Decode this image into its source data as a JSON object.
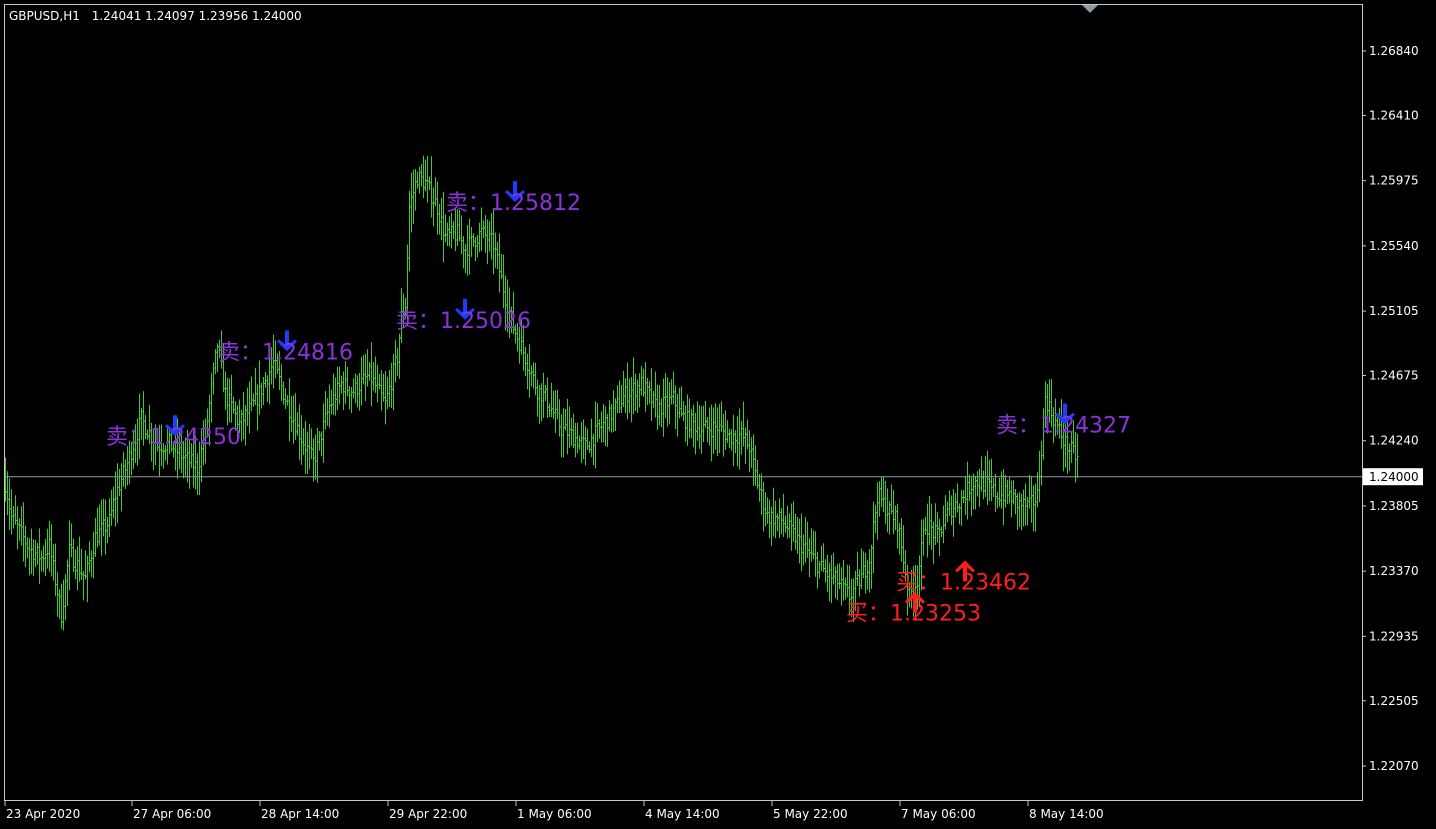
{
  "header": {
    "symbol_timeframe": "GBPUSD,H1",
    "ohlc": "1.24041 1.24097 1.23956 1.24000"
  },
  "colors": {
    "background": "#000000",
    "frame": "#c8c8c8",
    "bars": "#46c832",
    "price_line": "#8c9ba5",
    "sell_arrow": "#1e3cff",
    "buy_arrow": "#ff1e1e",
    "sell_label": "#8c32dc",
    "buy_label": "#ff1e1e",
    "triangle": "#8c9ba5"
  },
  "chart_data": {
    "type": "ohlc",
    "symbol": "GBPUSD",
    "timeframe": "H1",
    "y_ticks": [
      "1.26840",
      "1.26410",
      "1.25975",
      "1.25540",
      "1.25105",
      "1.24675",
      "1.24240",
      "1.23805",
      "1.23370",
      "1.22935",
      "1.22505",
      "1.22070"
    ],
    "ylim": [
      1.2175,
      1.2708
    ],
    "x_ticks": [
      "23 Apr 2020",
      "27 Apr 06:00",
      "28 Apr 14:00",
      "29 Apr 22:00",
      "1 May 06:00",
      "4 May 14:00",
      "5 May 22:00",
      "7 May 06:00",
      "8 May 14:00"
    ],
    "current_price": "1.24000",
    "bar_count": 270,
    "trend_close": [
      [
        0,
        1.2396
      ],
      [
        3,
        1.2373
      ],
      [
        12,
        1.2352
      ],
      [
        18,
        1.2346
      ],
      [
        22,
        1.2354
      ],
      [
        28,
        1.2308
      ],
      [
        32,
        1.235
      ],
      [
        40,
        1.2332
      ],
      [
        45,
        1.236
      ],
      [
        52,
        1.237
      ],
      [
        55,
        1.2388
      ],
      [
        60,
        1.2405
      ],
      [
        68,
        1.2438
      ],
      [
        76,
        1.2421
      ],
      [
        82,
        1.2422
      ],
      [
        89,
        1.2413
      ],
      [
        96,
        1.2406
      ],
      [
        100,
        1.2428
      ],
      [
        106,
        1.2488
      ],
      [
        110,
        1.2455
      ],
      [
        117,
        1.2435
      ],
      [
        125,
        1.245
      ],
      [
        134,
        1.2476
      ],
      [
        140,
        1.2452
      ],
      [
        148,
        1.2426
      ],
      [
        154,
        1.241
      ],
      [
        162,
        1.2447
      ],
      [
        168,
        1.2462
      ],
      [
        174,
        1.2457
      ],
      [
        182,
        1.2468
      ],
      [
        190,
        1.2448
      ],
      [
        196,
        1.248
      ],
      [
        198,
        1.2507
      ],
      [
        200,
        1.2515
      ],
      [
        202,
        1.258
      ],
      [
        206,
        1.26
      ],
      [
        210,
        1.2596
      ],
      [
        216,
        1.258
      ],
      [
        220,
        1.256
      ],
      [
        226,
        1.2562
      ],
      [
        230,
        1.2552
      ],
      [
        238,
        1.2563
      ],
      [
        244,
        1.2555
      ],
      [
        250,
        1.252
      ],
      [
        254,
        1.25
      ],
      [
        260,
        1.248
      ],
      [
        266,
        1.2458
      ],
      [
        270,
        1.2453
      ],
      [
        278,
        1.2432
      ],
      [
        284,
        1.2427
      ],
      [
        290,
        1.242
      ],
      [
        296,
        1.243
      ],
      [
        302,
        1.244
      ],
      [
        310,
        1.2455
      ],
      [
        318,
        1.2462
      ],
      [
        326,
        1.2445
      ],
      [
        334,
        1.2452
      ],
      [
        338,
        1.244
      ],
      [
        348,
        1.2432
      ],
      [
        356,
        1.2433
      ],
      [
        362,
        1.2427
      ],
      [
        368,
        1.2428
      ],
      [
        372,
        1.242
      ],
      [
        376,
        1.2396
      ],
      [
        381,
        1.2374
      ],
      [
        388,
        1.2371
      ],
      [
        396,
        1.2358
      ],
      [
        404,
        1.2345
      ],
      [
        410,
        1.2336
      ],
      [
        416,
        1.233
      ],
      [
        422,
        1.232
      ],
      [
        428,
        1.2333
      ],
      [
        432,
        1.2345
      ],
      [
        436,
        1.2388
      ],
      [
        440,
        1.238
      ],
      [
        446,
        1.237
      ],
      [
        452,
        1.232
      ],
      [
        456,
        1.2332
      ],
      [
        460,
        1.2369
      ],
      [
        466,
        1.236
      ],
      [
        472,
        1.2378
      ],
      [
        478,
        1.2385
      ],
      [
        484,
        1.2397
      ],
      [
        490,
        1.2395
      ],
      [
        496,
        1.2388
      ],
      [
        502,
        1.2388
      ],
      [
        506,
        1.2382
      ],
      [
        512,
        1.238
      ],
      [
        516,
        1.2387
      ],
      [
        520,
        1.2453
      ],
      [
        525,
        1.2436
      ],
      [
        530,
        1.2422
      ],
      [
        536,
        1.2412
      ]
    ],
    "signals": [
      {
        "side": "sell",
        "label": "卖：1.24250",
        "bar": 85,
        "price": 1.2425
      },
      {
        "side": "sell",
        "label": "卖：1.24816",
        "bar": 141,
        "price": 1.24816
      },
      {
        "side": "sell",
        "label": "卖：1.25026",
        "bar": 230,
        "price": 1.25026
      },
      {
        "side": "sell",
        "label": "卖：1.25812",
        "bar": 255,
        "price": 1.25812
      },
      {
        "side": "buy",
        "label": "买：1.23253",
        "bar": 455,
        "price": 1.23253
      },
      {
        "side": "buy",
        "label": "买：1.23462",
        "bar": 480,
        "price": 1.23462
      },
      {
        "side": "sell",
        "label": "卖：1.24327",
        "bar": 530,
        "price": 1.24327
      }
    ]
  }
}
